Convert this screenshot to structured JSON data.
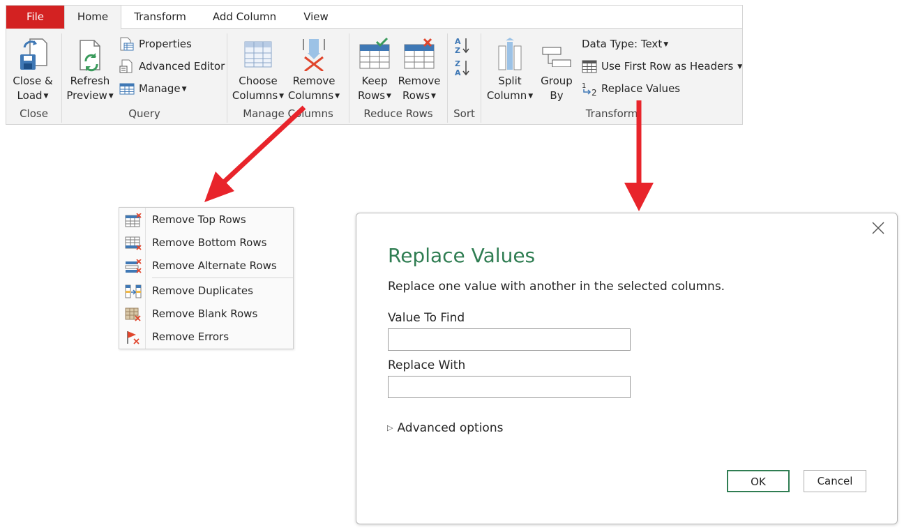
{
  "ribbon": {
    "tabs": {
      "file": "File",
      "home": "Home",
      "transform": "Transform",
      "add_column": "Add Column",
      "view": "View"
    },
    "groups": {
      "close": "Close",
      "query": "Query",
      "manage_columns": "Manage Columns",
      "reduce_rows": "Reduce Rows",
      "sort": "Sort",
      "transform": "Transform"
    },
    "buttons": {
      "close_load": [
        "Close &",
        "Load"
      ],
      "refresh_preview": [
        "Refresh",
        "Preview"
      ],
      "properties": "Properties",
      "advanced_editor": "Advanced Editor",
      "manage": "Manage",
      "choose_columns": [
        "Choose",
        "Columns"
      ],
      "remove_columns": [
        "Remove",
        "Columns"
      ],
      "keep_rows": [
        "Keep",
        "Rows"
      ],
      "remove_rows": [
        "Remove",
        "Rows"
      ],
      "split_column": [
        "Split",
        "Column"
      ],
      "group_by": [
        "Group",
        "By"
      ],
      "data_type": "Data Type: Text",
      "use_first_row": "Use First Row as Headers",
      "replace_values": "Replace Values"
    },
    "colors": {
      "file_tab": "#d32222",
      "accent_blue": "#3f78b5",
      "accent_red": "#e0452c",
      "accent_green": "#2f7d52"
    }
  },
  "menu": {
    "items": [
      {
        "label": "Remove Top Rows",
        "icon": "remove-top-rows-icon"
      },
      {
        "label": "Remove Bottom Rows",
        "icon": "remove-bottom-rows-icon"
      },
      {
        "label": "Remove Alternate Rows",
        "icon": "remove-alternate-rows-icon"
      },
      {
        "label": "Remove Duplicates",
        "icon": "remove-duplicates-icon"
      },
      {
        "label": "Remove Blank Rows",
        "icon": "remove-blank-rows-icon"
      },
      {
        "label": "Remove Errors",
        "icon": "remove-errors-icon"
      }
    ]
  },
  "dialog": {
    "title": "Replace Values",
    "description": "Replace one value with another in the selected columns.",
    "value_to_find_label": "Value To Find",
    "value_to_find": "",
    "replace_with_label": "Replace With",
    "replace_with": "",
    "advanced_options": "Advanced options",
    "ok": "OK",
    "cancel": "Cancel"
  }
}
